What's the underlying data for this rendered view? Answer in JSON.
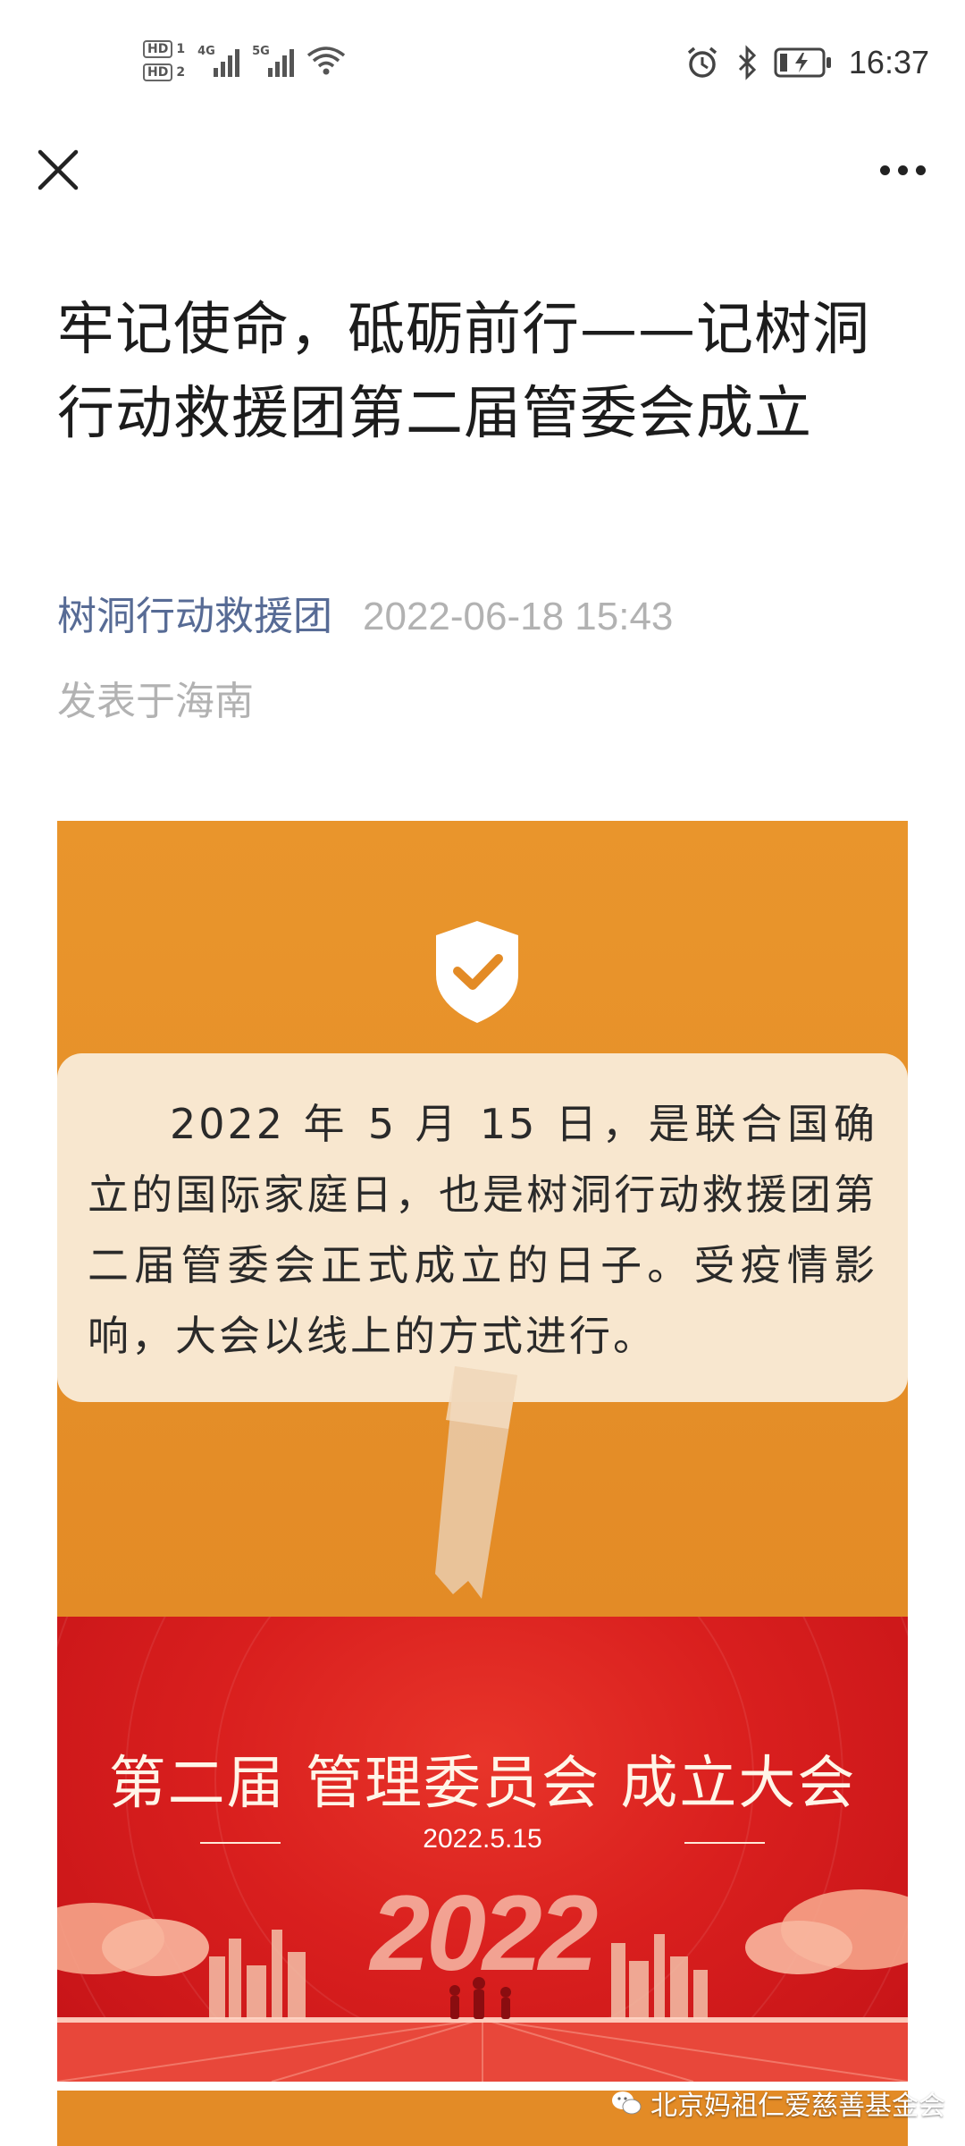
{
  "status_bar": {
    "hd1": "HD",
    "hd1_num": "1",
    "hd2": "HD",
    "hd2_num": "2",
    "signal1_gen": "4G",
    "signal2_gen": "5G",
    "time": "16:37",
    "icons": [
      "alarm-icon",
      "bluetooth-icon",
      "battery-charging-icon"
    ]
  },
  "nav": {
    "close_icon": "close-icon",
    "more_icon": "more-icon"
  },
  "article": {
    "title": "牢记使命，砥砺前行——记树洞行动救援团第二届管委会成立",
    "author": "树洞行动救援团",
    "date": "2022-06-18 15:43",
    "location": "发表于海南"
  },
  "image1": {
    "note_text": "2022 年 5 月 15 日，是联合国确立的国际家庭日，也是树洞行动救援团第二届管委会正式成立的日子。受疫情影响，大会以线上的方式进行。",
    "colors": {
      "panel": "#e38b26",
      "card": "#f8e7cf"
    }
  },
  "image2": {
    "title": "第二届  管理委员会  成立大会",
    "date": "2022.5.15",
    "year": "2022",
    "colors": {
      "banner": "#d91f1e"
    }
  },
  "watermark": {
    "text": "北京妈祖仁爱慈善基金会",
    "icon": "wechat-icon"
  }
}
